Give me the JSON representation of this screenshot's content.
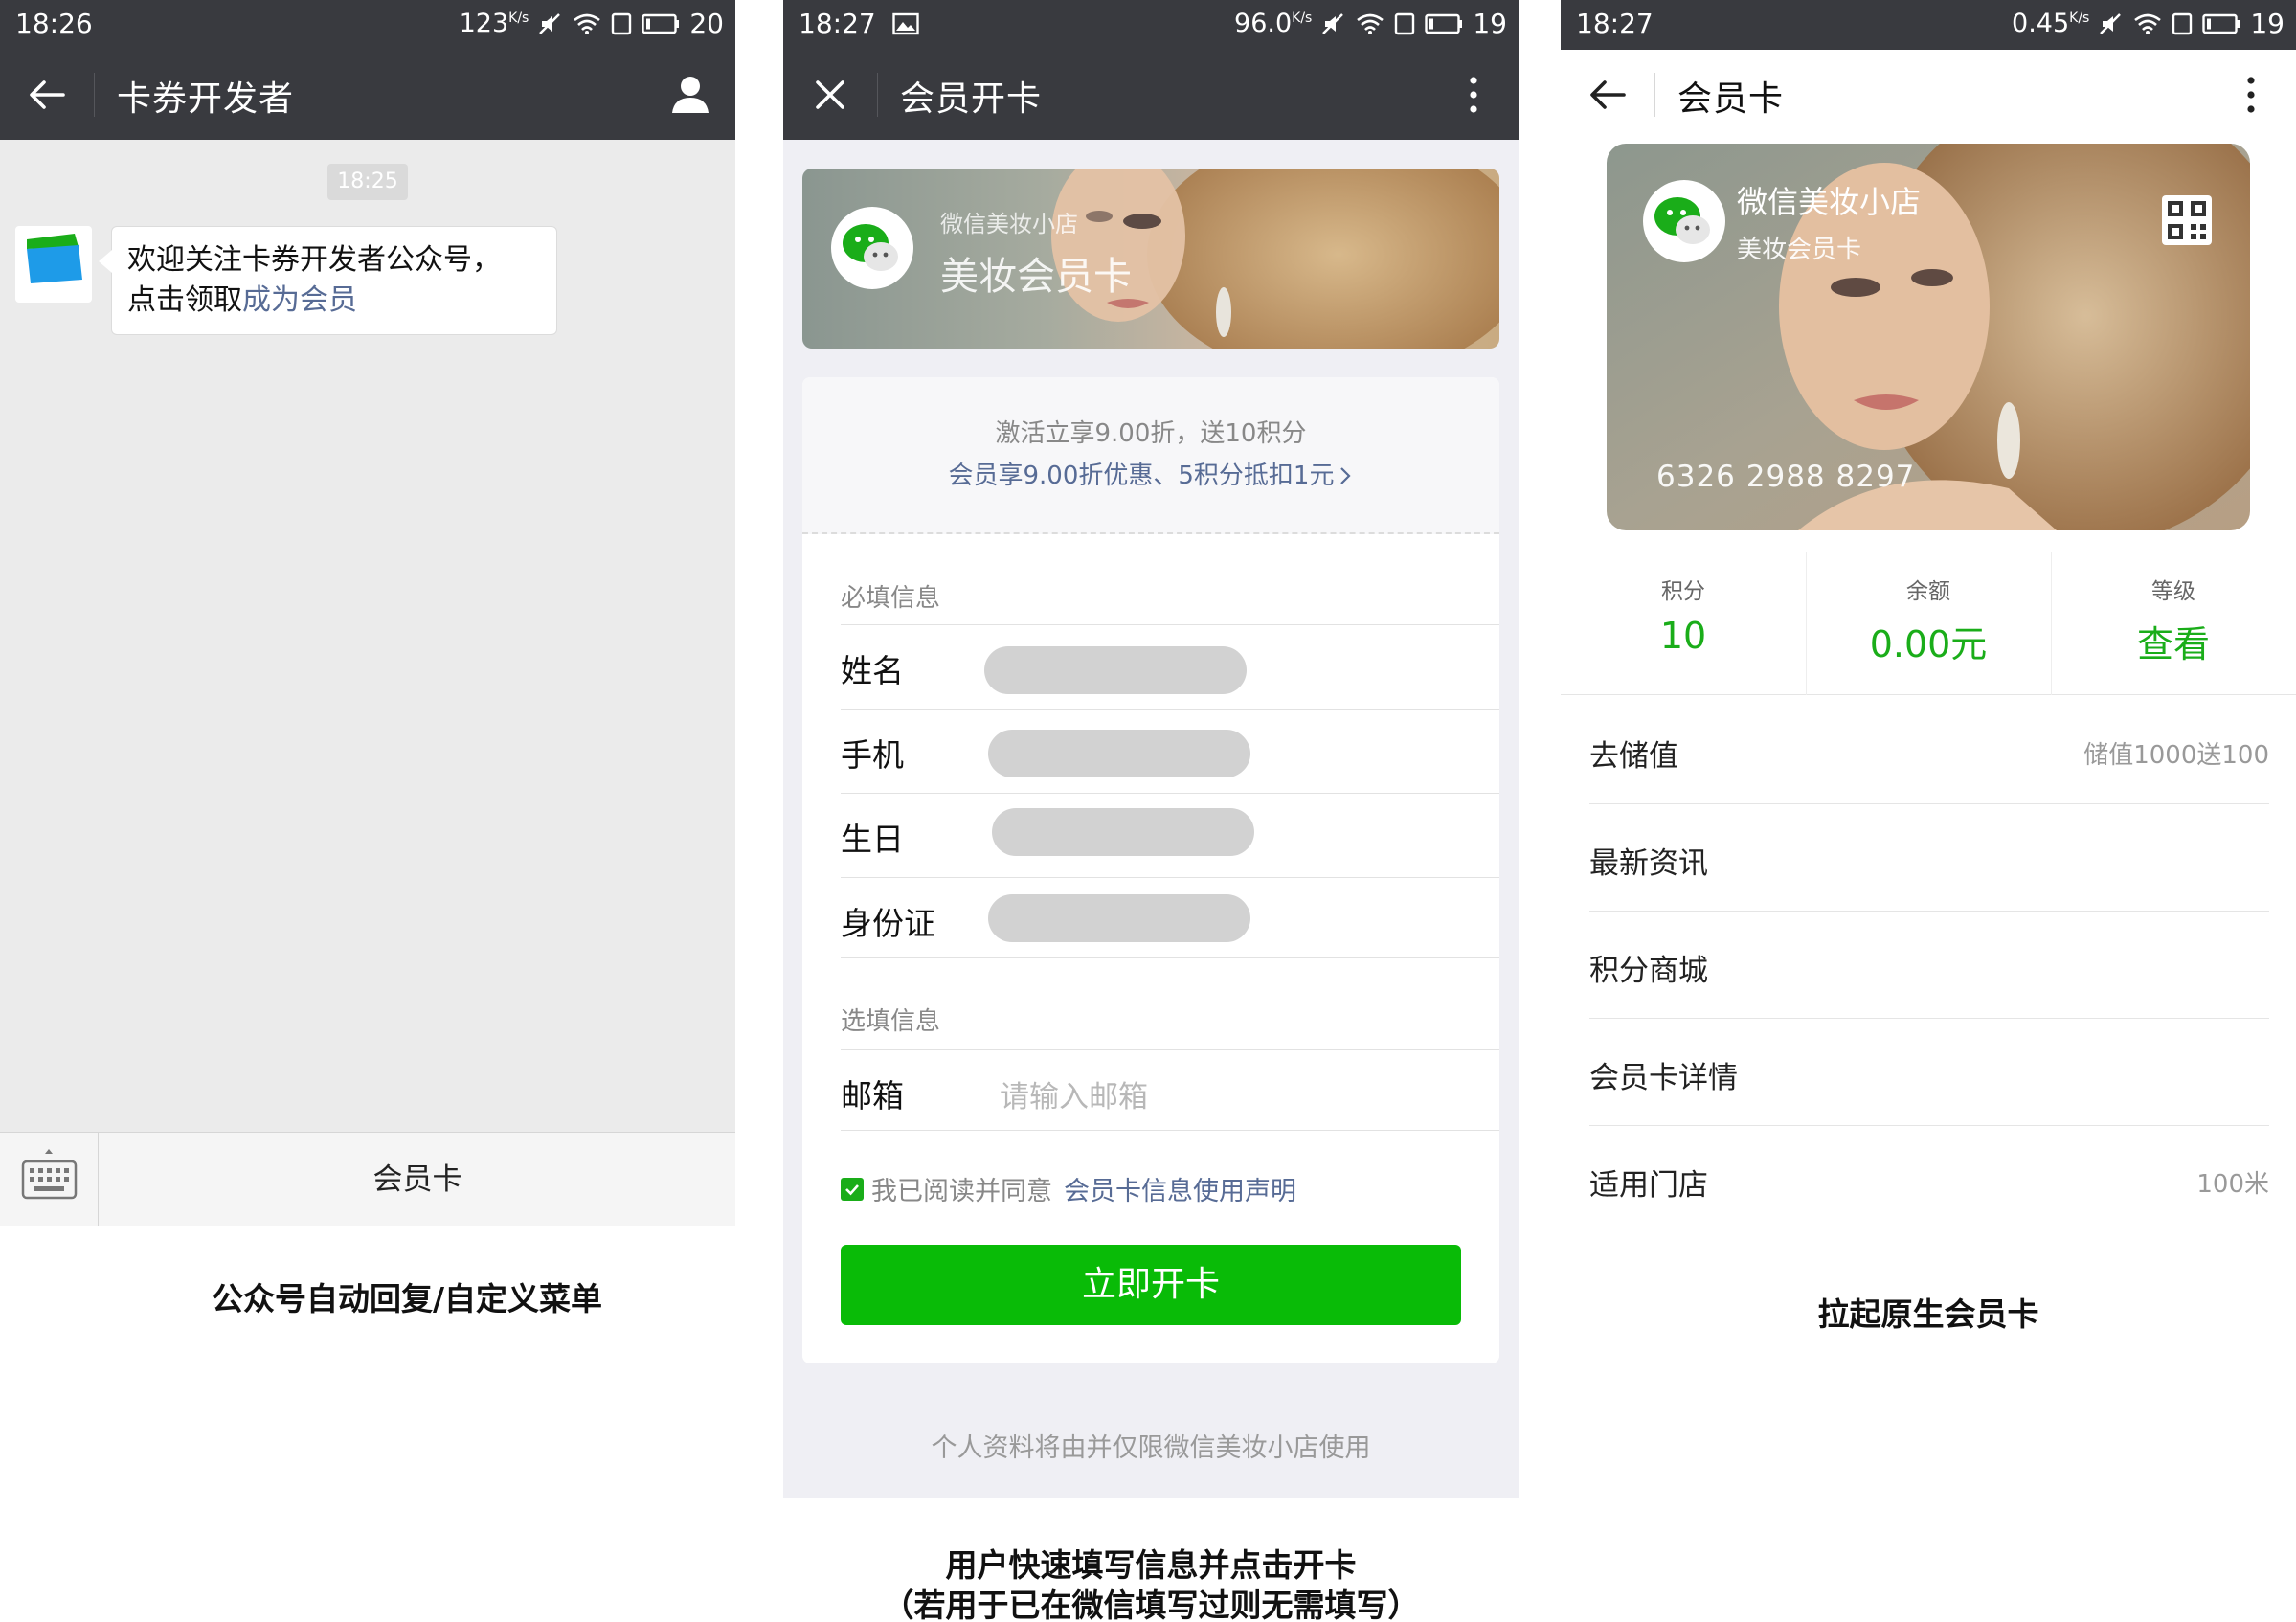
{
  "screens": [
    {
      "status": {
        "time": "18:26",
        "speed": "123",
        "speed_unit": "K/s",
        "battery": "20"
      },
      "nav": {
        "title": "卡券开发者"
      },
      "chat": {
        "time_chip": "18:25",
        "message_line1": "欢迎关注卡券开发者公众号，",
        "message_line2_prefix": "点击领取",
        "message_link": "成为会员"
      },
      "menu": {
        "label": "会员卡"
      },
      "caption": "公众号自动回复/自定义菜单"
    },
    {
      "status": {
        "time": "18:27",
        "speed": "96.0",
        "speed_unit": "K/s",
        "battery": "19"
      },
      "nav": {
        "title": "会员开卡"
      },
      "hero": {
        "shop": "微信美妆小店",
        "card": "美妆会员卡"
      },
      "promo": {
        "line1": "激活立享9.00折，送10积分",
        "line2": "会员享9.00折优惠、5积分抵扣1元"
      },
      "form": {
        "required_label": "必填信息",
        "fields": [
          {
            "label": "姓名"
          },
          {
            "label": "手机"
          },
          {
            "label": "生日"
          },
          {
            "label": "身份证"
          }
        ],
        "optional_label": "选填信息",
        "email_label": "邮箱",
        "email_placeholder": "请输入邮箱",
        "agree_text": "我已阅读并同意",
        "agree_link": "会员卡信息使用声明",
        "submit": "立即开卡"
      },
      "privacy": "个人资料将由并仅限微信美妆小店使用",
      "caption_line1": "用户快速填写信息并点击开卡",
      "caption_line2": "（若用于已在微信填写过则无需填写）"
    },
    {
      "status": {
        "time": "18:27",
        "speed": "0.45",
        "speed_unit": "K/s",
        "battery": "19"
      },
      "nav": {
        "title": "会员卡"
      },
      "card": {
        "shop": "微信美妆小店",
        "type": "美妆会员卡",
        "number": "6326 2988 8297"
      },
      "stats": [
        {
          "label": "积分",
          "value": "10"
        },
        {
          "label": "余额",
          "value": "0.00元"
        },
        {
          "label": "等级",
          "value": "查看"
        }
      ],
      "list": [
        {
          "label": "去储值",
          "value": "储值1000送100"
        },
        {
          "label": "最新资讯",
          "value": ""
        },
        {
          "label": "积分商城",
          "value": ""
        },
        {
          "label": "会员卡详情",
          "value": ""
        },
        {
          "label": "适用门店",
          "value": "100米"
        }
      ],
      "caption": "拉起原生会员卡"
    }
  ],
  "colors": {
    "titlebar": "#393a3f",
    "wechat_green": "#09bb07",
    "stat_green": "#1aad19",
    "link_blue": "#576b95"
  },
  "icons": [
    "back-arrow-icon",
    "profile-icon",
    "close-icon",
    "more-dots-icon",
    "keyboard-icon",
    "wechat-logo-icon",
    "qrcode-icon",
    "checkbox-checked-icon",
    "chevron-right-icon",
    "wifi-icon",
    "mute-icon",
    "battery-icon",
    "image-icon",
    "sim-icon"
  ]
}
